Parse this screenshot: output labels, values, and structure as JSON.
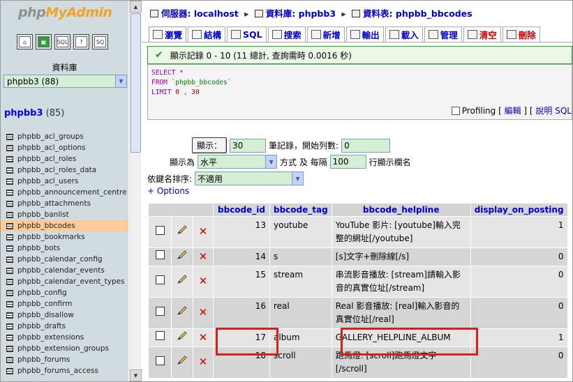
{
  "sidebar": {
    "logo_part1": "php",
    "logo_part2": "MyAdmin",
    "icons": [
      "home-icon",
      "exit-icon",
      "sql-icon",
      "help-icon",
      "docs-icon"
    ],
    "icon_labels": [
      "⌂",
      "▣",
      "SQL",
      "?",
      "SQ"
    ],
    "db_label": "資料庫",
    "db_select": "phpbb3 (88)",
    "db_title": "phpbb3",
    "db_count": "(85)",
    "tables": [
      "phpbb_acl_groups",
      "phpbb_acl_options",
      "phpbb_acl_roles",
      "phpbb_acl_roles_data",
      "phpbb_acl_users",
      "phpbb_announcement_centre",
      "phpbb_attachments",
      "phpbb_banlist",
      "phpbb_bbcodes",
      "phpbb_bookmarks",
      "phpbb_bots",
      "phpbb_calendar_config",
      "phpbb_calendar_events",
      "phpbb_calendar_event_types",
      "phpbb_config",
      "phpbb_confirm",
      "phpbb_disallow",
      "phpbb_drafts",
      "phpbb_extensions",
      "phpbb_extension_groups",
      "phpbb_forums",
      "phpbb_forums_access"
    ],
    "active_table": "phpbb_bbcodes"
  },
  "breadcrumb": {
    "server_label": "伺服器:",
    "server": "localhost",
    "db_label": "資料庫:",
    "db": "phpbb3",
    "table_label": "資料表:",
    "table": "phpbb_bbcodes"
  },
  "tabs": [
    "瀏覽",
    "結構",
    "SQL",
    "搜索",
    "新增",
    "輸出",
    "載入",
    "管理",
    "清空",
    "刪除"
  ],
  "notice": "顯示記錄 0 - 10 (11 總計, 查詢需時 0.0016 秒)",
  "sql": {
    "line1_kw": "SELECT",
    "line1_rest": "*",
    "line2_kw": "FROM",
    "line2_rest": "`phpbb_bbcodes`",
    "line3_kw": "LIMIT",
    "line3_a": "0",
    "line3_sep": ",",
    "line3_b": "30",
    "profiling": "Profiling",
    "edit": "編輯",
    "explain": "說明 SQL"
  },
  "controls": {
    "show_button": "顯示：",
    "rows_value": "30",
    "rows_label": "筆記錄，開始列數:",
    "start_value": "0",
    "mode_label": "顯示為",
    "mode_value": "水平",
    "mode_suffix": "方式 及 每隔",
    "repeat_value": "100",
    "repeat_label": "行顯示欄名",
    "sort_label": "依鍵名排序:",
    "sort_value": "不適用",
    "options_link": "+ Options"
  },
  "table": {
    "columns": [
      "bbcode_id",
      "bbcode_tag",
      "bbcode_helpline",
      "display_on_posting"
    ],
    "rows": [
      {
        "id": "13",
        "tag": "youtube",
        "help": "YouTube 影片: [youtube]輸入完整的網址[/youtube]",
        "display": "1"
      },
      {
        "id": "14",
        "tag": "s",
        "help": "[s]文字+刪除線[/s]",
        "display": "0"
      },
      {
        "id": "15",
        "tag": "stream",
        "help": "串流影音播放: [stream]請輸入影音的真實位址[/stream]",
        "display": "0"
      },
      {
        "id": "16",
        "tag": "real",
        "help": "Real 影音播放: [real]輸入影音的真實位址[/real]",
        "display": "0"
      },
      {
        "id": "17",
        "tag": "album",
        "help": "GALLERY_HELPLINE_ALBUM",
        "display": "1"
      },
      {
        "id": "18",
        "tag": "scroll",
        "help": "跑馬燈: [scroll]跑馬燈文字[/scroll]",
        "display": "0"
      }
    ]
  },
  "colors": {
    "sidebar_bg": "#d0dce0",
    "active_table_bg": "#ffcc99",
    "link": "#0000cc",
    "highlight": "#d42020",
    "notice_border": "#2aa22a"
  }
}
